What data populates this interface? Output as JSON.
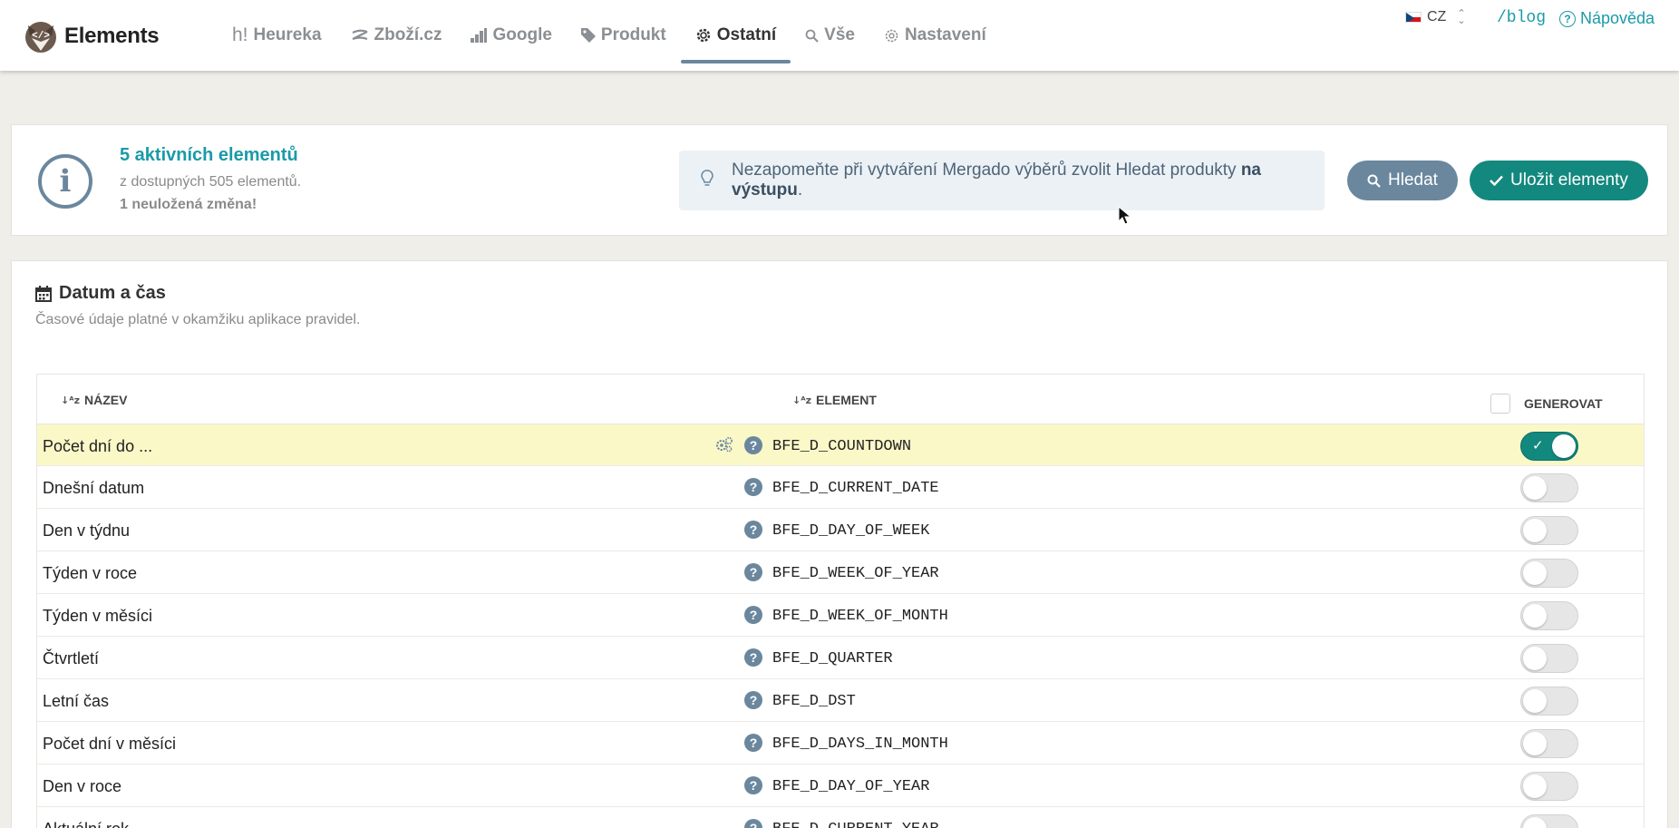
{
  "app": {
    "name": "Elements"
  },
  "nav": {
    "items": [
      {
        "label": "Heureka",
        "icon": "heureka-icon",
        "active": false
      },
      {
        "label": "Zboží.cz",
        "icon": "zbozi-icon",
        "active": false
      },
      {
        "label": "Google",
        "icon": "chart-icon",
        "active": false
      },
      {
        "label": "Produkt",
        "icon": "tag-icon",
        "active": false
      },
      {
        "label": "Ostatní",
        "icon": "gear-icon",
        "active": true
      },
      {
        "label": "Vše",
        "icon": "search-icon",
        "active": false
      },
      {
        "label": "Nastavení",
        "icon": "cog-icon",
        "active": false
      }
    ]
  },
  "lang": {
    "code": "CZ"
  },
  "blog": "/blog",
  "help": {
    "label": "Nápověda"
  },
  "info": {
    "title": "5 aktivních elementů",
    "subtitle": "z dostupných 505 elementů.",
    "unsaved": "1 neuložená změna!"
  },
  "tip": {
    "text_before": "Nezapomeňte při vytváření Mergado výběrů zvolit Hledat produkty ",
    "bold": "na výstupu",
    "text_after": "."
  },
  "buttons": {
    "search": "Hledat",
    "save": "Uložit elementy"
  },
  "section": {
    "title": "Datum a čas",
    "subtitle": "Časové údaje platné v okamžiku aplikace pravidel."
  },
  "table": {
    "col_name": "NÁZEV",
    "col_element": "ELEMENT",
    "col_generate": "GENEROVAT",
    "rows": [
      {
        "name": "Počet dní do ...",
        "element": "BFE_D_COUNTDOWN",
        "enabled": true,
        "has_settings": true
      },
      {
        "name": "Dnešní datum",
        "element": "BFE_D_CURRENT_DATE",
        "enabled": false
      },
      {
        "name": "Den v týdnu",
        "element": "BFE_D_DAY_OF_WEEK",
        "enabled": false
      },
      {
        "name": "Týden v roce",
        "element": "BFE_D_WEEK_OF_YEAR",
        "enabled": false
      },
      {
        "name": "Týden v měsíci",
        "element": "BFE_D_WEEK_OF_MONTH",
        "enabled": false
      },
      {
        "name": "Čtvrtletí",
        "element": "BFE_D_QUARTER",
        "enabled": false
      },
      {
        "name": "Letní čas",
        "element": "BFE_D_DST",
        "enabled": false
      },
      {
        "name": "Počet dní v měsíci",
        "element": "BFE_D_DAYS_IN_MONTH",
        "enabled": false
      },
      {
        "name": "Den v roce",
        "element": "BFE_D_DAY_OF_YEAR",
        "enabled": false
      },
      {
        "name": "Aktuální rok",
        "element": "BFE_D_CURRENT_YEAR",
        "enabled": false
      }
    ]
  },
  "colors": {
    "accent": "#1a9aa8",
    "primary": "#13887e",
    "secondary": "#6b879e",
    "highlight": "#fbf8c8"
  }
}
